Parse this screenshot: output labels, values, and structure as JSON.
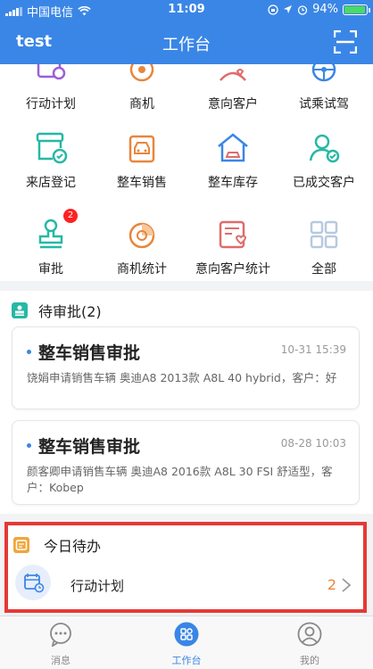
{
  "status_bar": {
    "carrier": "中国电信",
    "time": "11:09",
    "battery": "94%",
    "battery_level": 0.94
  },
  "nav": {
    "user": "test",
    "title": "工作台",
    "scan_icon": "scan-icon"
  },
  "grid": {
    "items": [
      {
        "label": "行动计划",
        "icon": "calendar-icon"
      },
      {
        "label": "商机",
        "icon": "opportunity-icon"
      },
      {
        "label": "意向客户",
        "icon": "heart-person-icon"
      },
      {
        "label": "试乘试驾",
        "icon": "steering-wheel-icon"
      },
      {
        "label": "来店登记",
        "icon": "register-icon"
      },
      {
        "label": "整车销售",
        "icon": "vehicle-sales-icon"
      },
      {
        "label": "整车库存",
        "icon": "warehouse-icon"
      },
      {
        "label": "已成交客户",
        "icon": "customer-check-icon"
      },
      {
        "label": "审批",
        "icon": "stamp-icon",
        "badge": "2"
      },
      {
        "label": "商机统计",
        "icon": "pie-chart-icon"
      },
      {
        "label": "意向客户统计",
        "icon": "report-heart-icon"
      },
      {
        "label": "全部",
        "icon": "grid-icon"
      }
    ]
  },
  "pending": {
    "title": "待审批(2)",
    "cards": [
      {
        "title": "整车销售审批",
        "time": "10-31 15:39",
        "desc": "饶娟申请销售车辆 奥迪A8 2013款 A8L 40 hybrid，客户：好"
      },
      {
        "title": "整车销售审批",
        "time": "08-28 10:03",
        "desc": "颜客卿申请销售车辆 奥迪A8 2016款 A8L 30 FSI 舒适型，客户：Kobep"
      }
    ]
  },
  "todo": {
    "title": "今日待办",
    "item_label": "行动计划",
    "item_count": "2"
  },
  "tabbar": {
    "tabs": [
      {
        "label": "消息",
        "icon": "message-icon"
      },
      {
        "label": "工作台",
        "icon": "workbench-icon"
      },
      {
        "label": "我的",
        "icon": "profile-icon"
      }
    ]
  },
  "colors": {
    "primary": "#3a86e6",
    "teal": "#26b8a5",
    "orange": "#e8863b",
    "highlight": "#e53935"
  }
}
